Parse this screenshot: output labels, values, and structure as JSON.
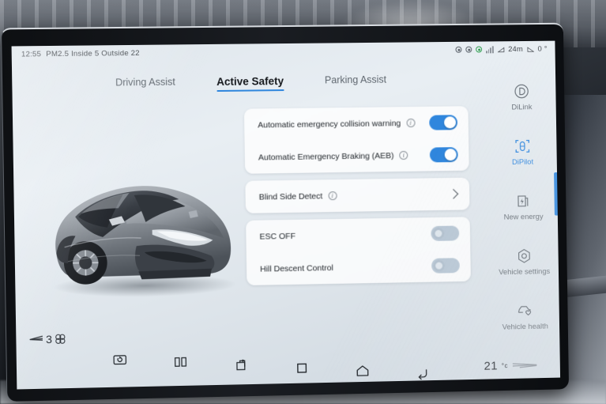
{
  "statusbar": {
    "time": "12:55",
    "air_quality": "PM2.5 Inside 5 Outside 22",
    "icons": [
      "location-icon",
      "settings-gear-icon",
      "recording-icon",
      "signal-bars-icon"
    ],
    "range": "24m",
    "incline": "0 °"
  },
  "tabs": [
    {
      "label": "Driving Assist",
      "active": false
    },
    {
      "label": "Active Safety",
      "active": true
    },
    {
      "label": "Parking Assist",
      "active": false
    }
  ],
  "cards": [
    {
      "rows": [
        {
          "label": "Automatic emergency collision warning",
          "info": true,
          "control": "toggle",
          "state": "on"
        },
        {
          "label": "Automatic Emergency Braking (AEB)",
          "info": true,
          "control": "toggle",
          "state": "on"
        }
      ]
    },
    {
      "rows": [
        {
          "label": "Blind Side Detect",
          "info": true,
          "control": "chevron",
          "state": ""
        }
      ]
    },
    {
      "rows": [
        {
          "label": "ESC OFF",
          "info": false,
          "control": "toggle",
          "state": "off"
        },
        {
          "label": "Hill Descent Control",
          "info": false,
          "control": "toggle",
          "state": "off"
        }
      ]
    }
  ],
  "sidebar": [
    {
      "label": "DiLink",
      "icon": "dilink-circle-d-icon",
      "active": false
    },
    {
      "label": "DiPilot",
      "icon": "dipilot-car-scan-icon",
      "active": true
    },
    {
      "label": "New energy",
      "icon": "new-energy-battery-icon",
      "active": false
    },
    {
      "label": "Vehicle settings",
      "icon": "vehicle-settings-hex-gear-icon",
      "active": false
    },
    {
      "label": "Vehicle health",
      "icon": "vehicle-health-heart-icon",
      "active": false
    }
  ],
  "climate": {
    "fan_speed": "3",
    "fan_icon": "fan-blades-icon",
    "temperature": "21",
    "temperature_unit": "°c",
    "airflow_icon": "airflow-lines-icon"
  },
  "navbar": [
    {
      "name": "screenshot-icon"
    },
    {
      "name": "split-screen-icon"
    },
    {
      "name": "rotate-screen-icon"
    },
    {
      "name": "recent-apps-icon"
    },
    {
      "name": "home-icon"
    },
    {
      "name": "back-icon"
    }
  ],
  "vehicle_image": {
    "alt": "grey-electric-suv-render"
  },
  "colors": {
    "accent": "#2f86dd",
    "toggle_on": "#2f86dd",
    "toggle_off": "#b7c6d4",
    "screen_bg": "#e2e9ef",
    "card_bg": "#ffffff",
    "text_primary": "#21262b",
    "text_muted": "#5f676f"
  }
}
